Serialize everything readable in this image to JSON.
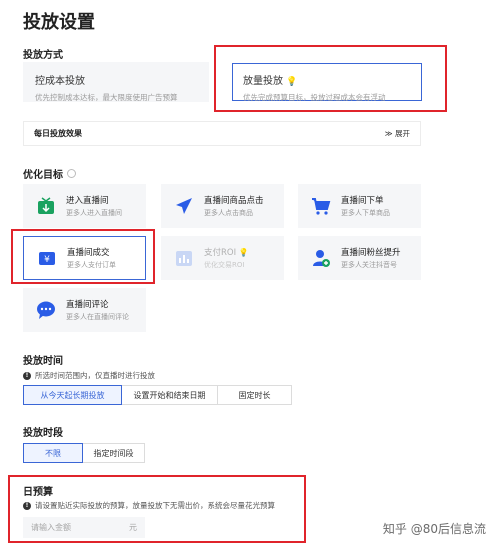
{
  "page": {
    "title": "投放设置"
  },
  "delivery_mode": {
    "heading": "投放方式",
    "options": [
      {
        "name": "控成本投放",
        "desc": "优先控制成本达标，最大限度使用广告预算"
      },
      {
        "name": "放量投放",
        "desc": "优先完成预算目标，投放过程成本会有浮动",
        "icon": "lightbulb-icon"
      }
    ]
  },
  "daily_effect": {
    "label": "每日投放效果",
    "toggle": "展开"
  },
  "goal": {
    "heading": "优化目标",
    "items": [
      {
        "name": "进入直播间",
        "desc": "更多人进入直播间",
        "icon": "tv-icon"
      },
      {
        "name": "直播间商品点击",
        "desc": "更多人点击商品",
        "icon": "send-icon"
      },
      {
        "name": "直播间下单",
        "desc": "更多人下单商品",
        "icon": "cart-icon"
      },
      {
        "name": "直播间成交",
        "desc": "更多人支付订单",
        "icon": "wallet-icon"
      },
      {
        "name": "支付ROI",
        "desc": "优化交易ROI",
        "icon": "chart-icon"
      },
      {
        "name": "直播间粉丝提升",
        "desc": "更多人关注抖音号",
        "icon": "user-add-icon"
      },
      {
        "name": "直播间评论",
        "desc": "更多人在直播间评论",
        "icon": "chat-icon"
      }
    ]
  },
  "time": {
    "heading": "投放时间",
    "note": "所选时间范围内，仅直播时进行投放",
    "options": [
      "从今天起长期投放",
      "设置开始和结束日期",
      "固定时长"
    ]
  },
  "period": {
    "heading": "投放时段",
    "options": [
      "不限",
      "指定时间段"
    ]
  },
  "budget": {
    "heading": "日预算",
    "note": "请设置贴近实际投放的预算，放量投放下无需出价，系统会尽量花光预算",
    "placeholder": "请输入金额",
    "unit": "元"
  },
  "watermark": "知乎 @80后信息流",
  "colors": {
    "accent": "#3a66d6",
    "highlight": "#e0242b"
  }
}
